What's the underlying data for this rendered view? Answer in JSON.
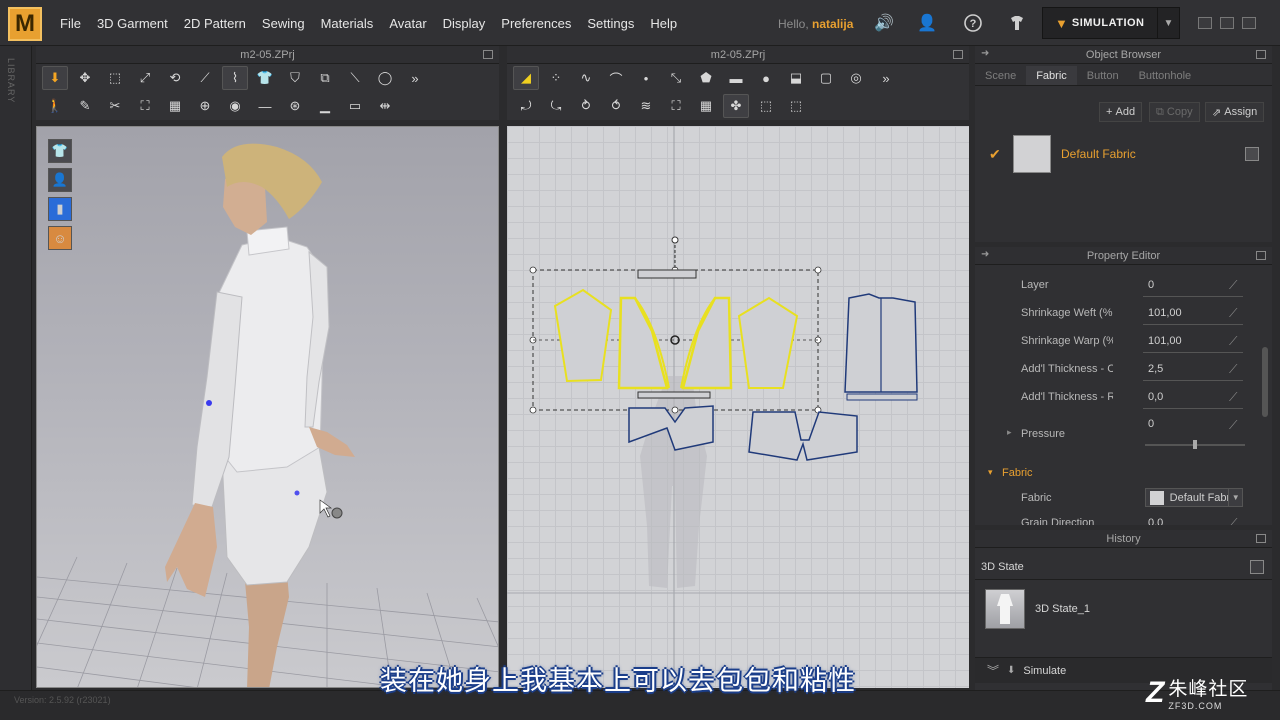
{
  "app": {
    "logo": "M",
    "title_3d": "m2-05.ZPrj",
    "title_2d": "m2-05.ZPrj"
  },
  "menu": [
    "File",
    "3D Garment",
    "2D Pattern",
    "Sewing",
    "Materials",
    "Avatar",
    "Display",
    "Preferences",
    "Settings",
    "Help"
  ],
  "user": {
    "greeting": "Hello,",
    "name": "natalija"
  },
  "simulation": {
    "label": "SIMULATION"
  },
  "library_label": "LIBRARY",
  "object_browser": {
    "title": "Object Browser",
    "tabs": [
      "Scene",
      "Fabric",
      "Button",
      "Buttonhole"
    ],
    "active_tab": "Fabric",
    "add_label": "Add",
    "copy_label": "Copy",
    "assign_label": "Assign",
    "fabric_name": "Default Fabric"
  },
  "property_editor": {
    "title": "Property Editor",
    "rows": [
      {
        "key": "Layer",
        "value": "0"
      },
      {
        "key": "Shrinkage Weft (%",
        "value": "101,00"
      },
      {
        "key": "Shrinkage Warp (%",
        "value": "101,00"
      },
      {
        "key": "Add'l Thickness - Collision",
        "value": "2,5"
      },
      {
        "key": "Add'l Thickness - Rendering",
        "value": "0,0"
      }
    ],
    "pressure_label": "Pressure",
    "pressure_value": "0",
    "fabric_section": "Fabric",
    "fabric_key": "Fabric",
    "fabric_value": "Default Fabric",
    "grain_key": "Grain Direction",
    "grain_value": "0,0"
  },
  "history": {
    "title": "History",
    "state_header": "3D State",
    "state_item": "3D State_1",
    "simulate_label": "Simulate"
  },
  "status": {
    "version": "Version: 2.5.92     (r23021)"
  },
  "subtitle": "装在她身上我基本上可以去包包和粘性",
  "watermark": {
    "brand": "朱峰社区",
    "url": "ZF3D.COM"
  },
  "colors": {
    "accent": "#e8a030",
    "selected_pattern": "#f0e020",
    "pattern_outline": "#203a7a"
  }
}
